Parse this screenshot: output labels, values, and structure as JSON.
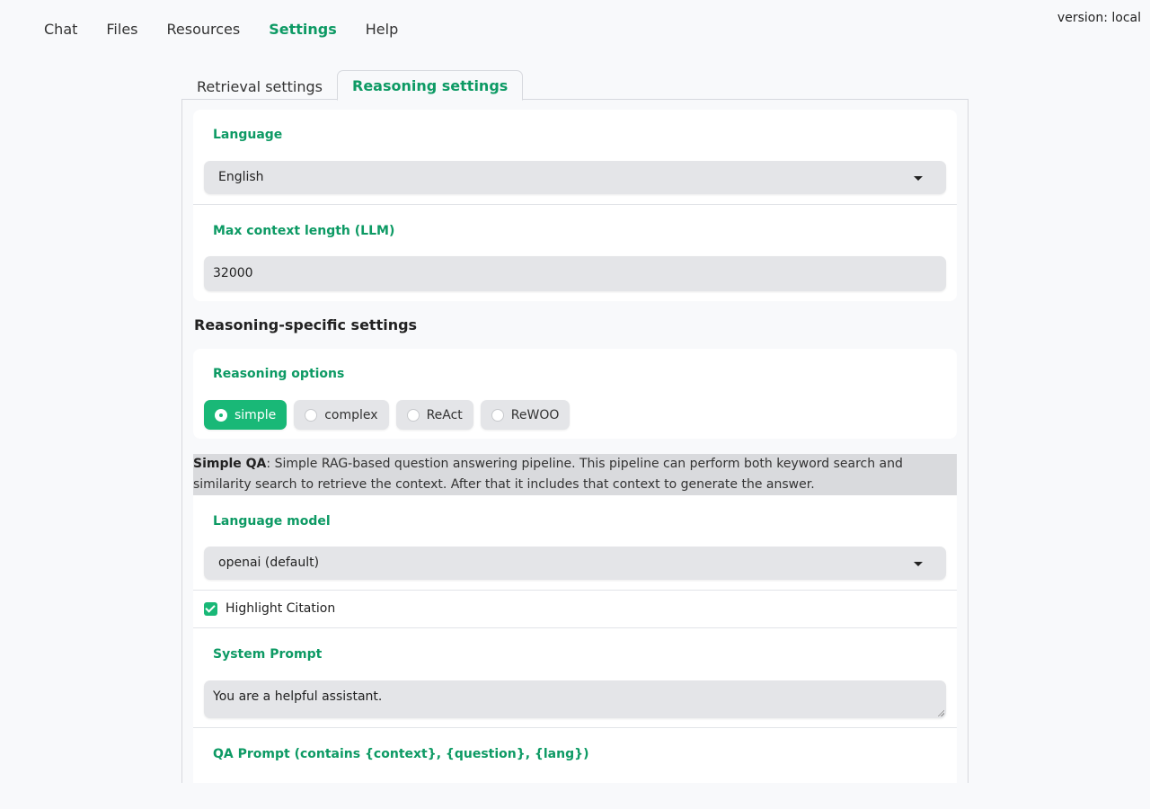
{
  "version": "version: local",
  "nav": [
    {
      "label": "Chat"
    },
    {
      "label": "Files"
    },
    {
      "label": "Resources"
    },
    {
      "label": "Settings"
    },
    {
      "label": "Help"
    }
  ],
  "nav_active": "Settings",
  "tabs": [
    {
      "label": "Retrieval settings"
    },
    {
      "label": "Reasoning settings"
    }
  ],
  "general": {
    "language_label": "Language",
    "language_value": "English",
    "max_context_label": "Max context length (LLM)",
    "max_context_value": "32000"
  },
  "reasoning": {
    "section_title": "Reasoning-specific settings",
    "options_label": "Reasoning options",
    "options": [
      {
        "label": "simple"
      },
      {
        "label": "complex"
      },
      {
        "label": "ReAct"
      },
      {
        "label": "ReWOO"
      }
    ],
    "selected_option": "simple",
    "description_bold": "Simple QA",
    "description_text": ": Simple RAG-based question answering pipeline. This pipeline can perform both keyword search and similarity search to retrieve the context. After that it includes that context to generate the answer.",
    "llm_label": "Language model",
    "llm_value": "openai (default)",
    "highlight_citation_label": "Highlight Citation",
    "highlight_citation_checked": true,
    "system_prompt_label": "System Prompt",
    "system_prompt_value": "You are a helpful assistant.",
    "qa_prompt_label": "QA Prompt (contains {context}, {question}, {lang})"
  },
  "colors": {
    "accent": "#0d9a64",
    "accent_fill": "#19b877",
    "field_bg": "#e4e5e8"
  }
}
